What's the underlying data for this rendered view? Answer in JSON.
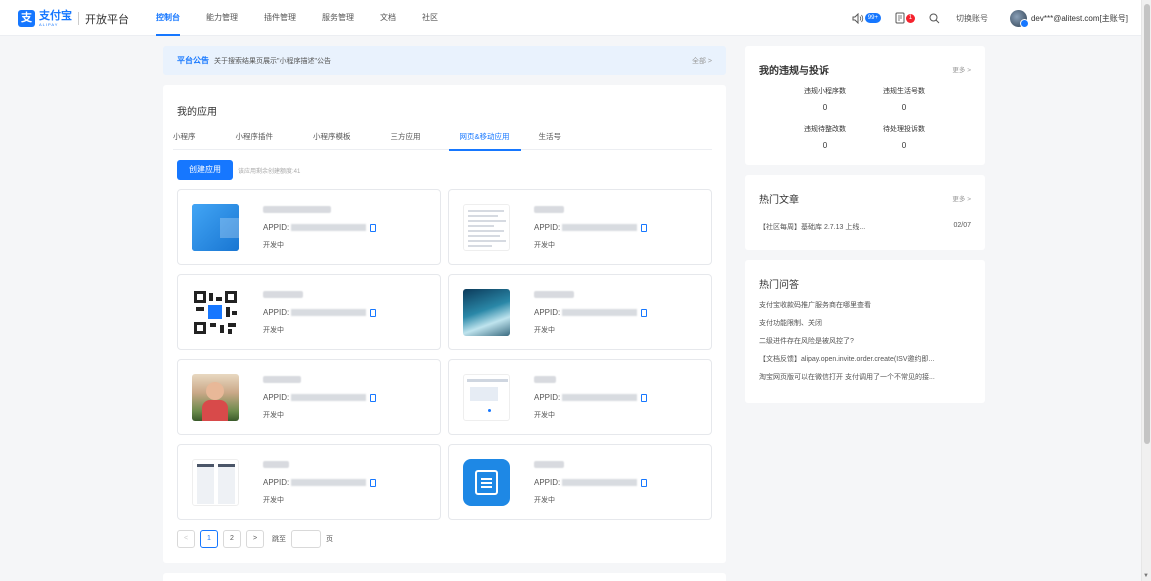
{
  "brand": {
    "logo_cn": "支付宝",
    "logo_en": "ALIPAY",
    "platform": "开放平台",
    "logo_char": "支"
  },
  "nav": {
    "items": [
      "控制台",
      "能力管理",
      "插件管理",
      "服务管理",
      "文档",
      "社区"
    ],
    "active_index": 0
  },
  "header_right": {
    "notice_badge": "99+",
    "todo_badge": "1",
    "switch_account": "切换账号",
    "user": "dev***@alitest.com[主账号]"
  },
  "announcement": {
    "label": "平台公告",
    "text": "关于搜索结果页展示\"小程序描述\"公告",
    "all_link": "全部 >"
  },
  "my_apps": {
    "title": "我的应用",
    "tabs": [
      "小程序",
      "小程序插件",
      "小程序模板",
      "三方应用",
      "网页&移动应用",
      "生活号"
    ],
    "active_tab": 4,
    "create_button": "创建应用",
    "quota_text": "该应用剩余创建额度:41",
    "appid_label": "APPID:",
    "apps": [
      {
        "thumb": "blue-window",
        "status": "开发中"
      },
      {
        "thumb": "document",
        "status": "开发中"
      },
      {
        "thumb": "qr-code",
        "status": "开发中"
      },
      {
        "thumb": "wave-photo",
        "status": "开发中"
      },
      {
        "thumb": "child-photo",
        "status": "开发中"
      },
      {
        "thumb": "web-page",
        "status": "开发中"
      },
      {
        "thumb": "phone-screens",
        "status": "开发中"
      },
      {
        "thumb": "file-icon",
        "status": "开发中"
      }
    ],
    "pagination": {
      "prev": "<",
      "pages": [
        "1",
        "2"
      ],
      "current": 1,
      "next": ">",
      "goto_label": "跳至",
      "page_unit": "页"
    }
  },
  "violations": {
    "title": "我的违规与投诉",
    "more": "更多 >",
    "stats": [
      {
        "label": "违规小程序数",
        "value": "0"
      },
      {
        "label": "违规生活号数",
        "value": "0"
      },
      {
        "label": "违规待整改数",
        "value": "0"
      },
      {
        "label": "待处理投诉数",
        "value": "0"
      }
    ]
  },
  "hot_articles": {
    "title": "热门文章",
    "more": "更多 >",
    "items": [
      {
        "title": "【社区每周】基础库 2.7.13 上线...",
        "date": "02/07"
      }
    ]
  },
  "hot_questions": {
    "title": "热门问答",
    "items": [
      "支付宝收款码推广服务商在哪里查看",
      "支付功能限制、关闭",
      "二级进件存在风险是被风控了?",
      "【文档反馈】alipay.open.invite.order.create(ISV邀约即...",
      "淘宝网页版可以在微信打开 支付调用了一个不常见的接..."
    ]
  }
}
